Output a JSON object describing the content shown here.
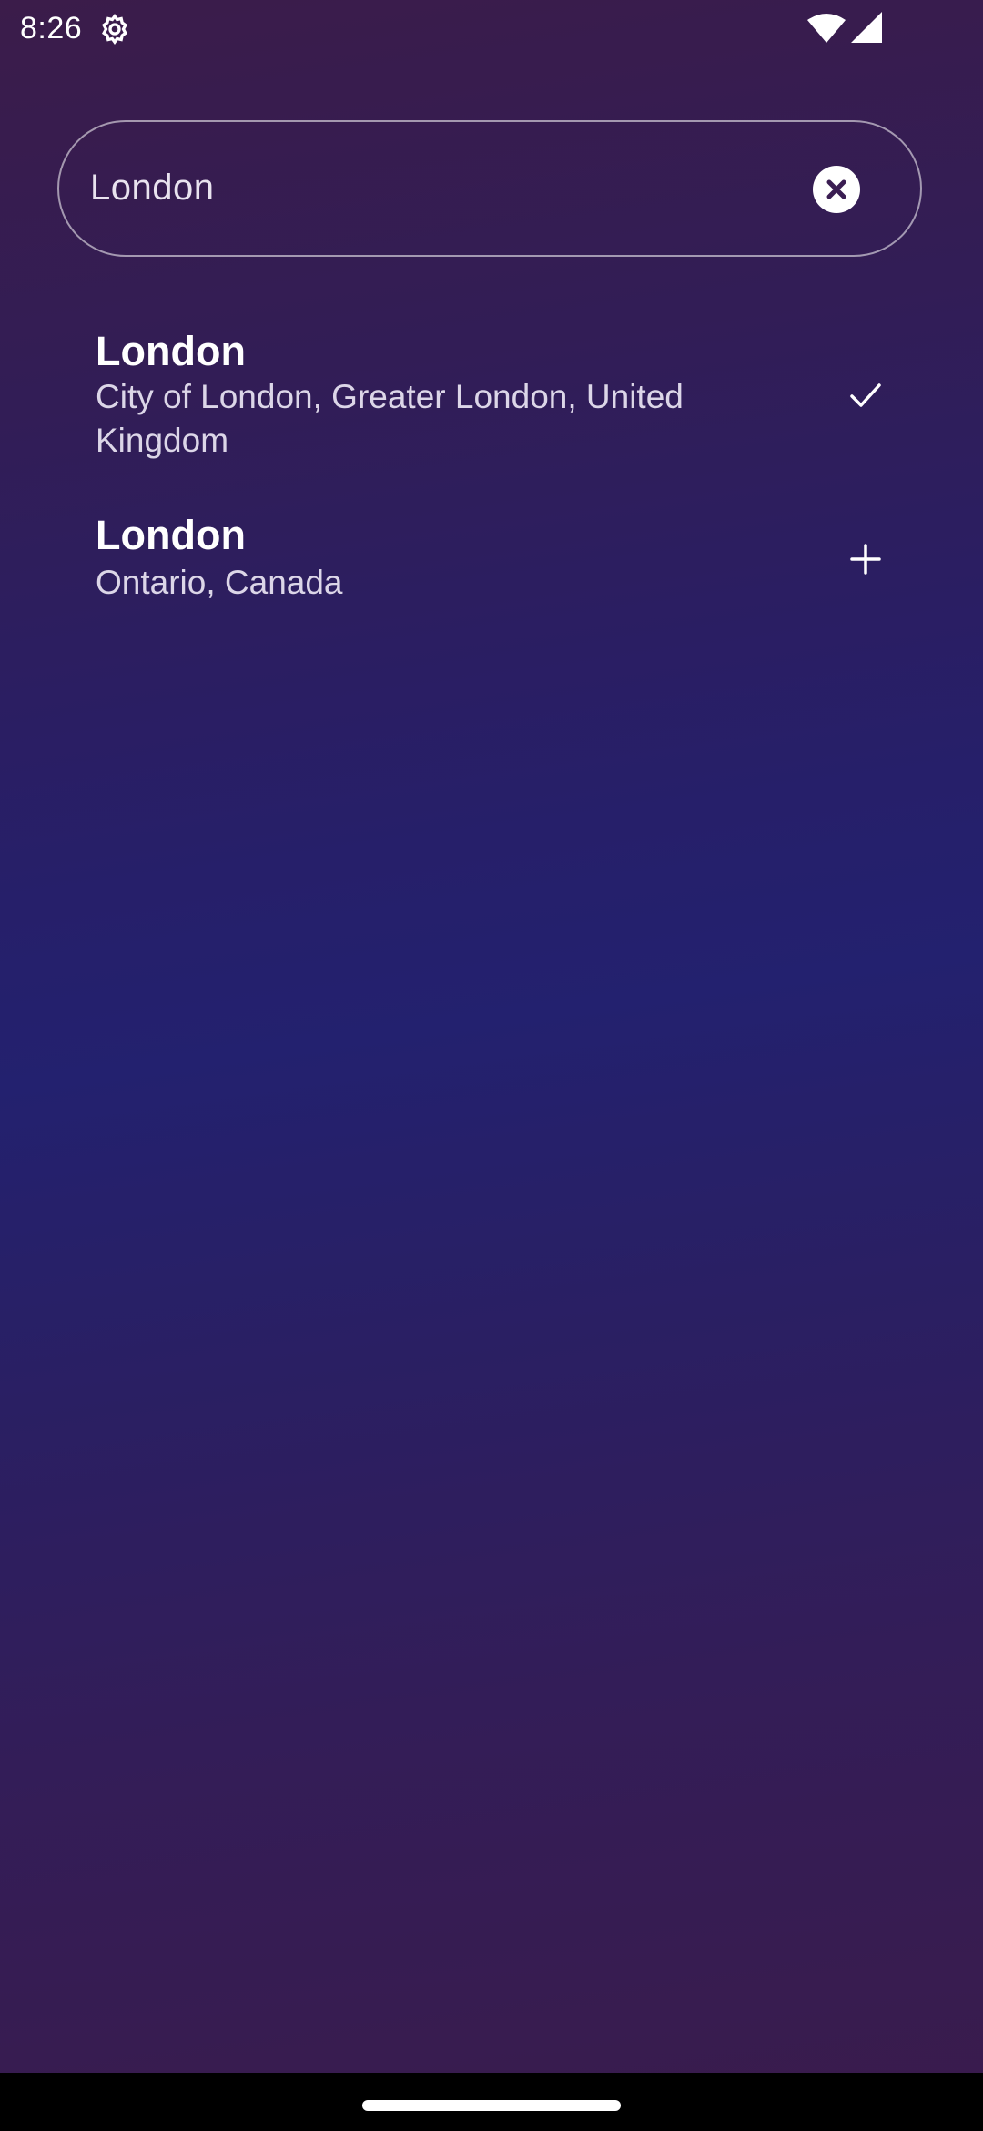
{
  "status_bar": {
    "time": "8:26",
    "icons": [
      "settings-gear-icon",
      "wifi-icon",
      "cell-signal-icon"
    ]
  },
  "search": {
    "value": "London",
    "clear_icon": "close-circle-icon"
  },
  "results": [
    {
      "title": "London",
      "subtitle": "City of London, Greater London, United Kingdom",
      "action_icon": "checkmark-icon",
      "state": "added"
    },
    {
      "title": "London",
      "subtitle": "Ontario, Canada",
      "action_icon": "plus-icon",
      "state": "not-added"
    }
  ],
  "colors": {
    "background_top": "#3b1c4a",
    "background_mid": "#23216f",
    "background_bottom": "#3a1b4c",
    "text_primary": "#ffffff",
    "text_secondary": "#dcd6e8"
  }
}
